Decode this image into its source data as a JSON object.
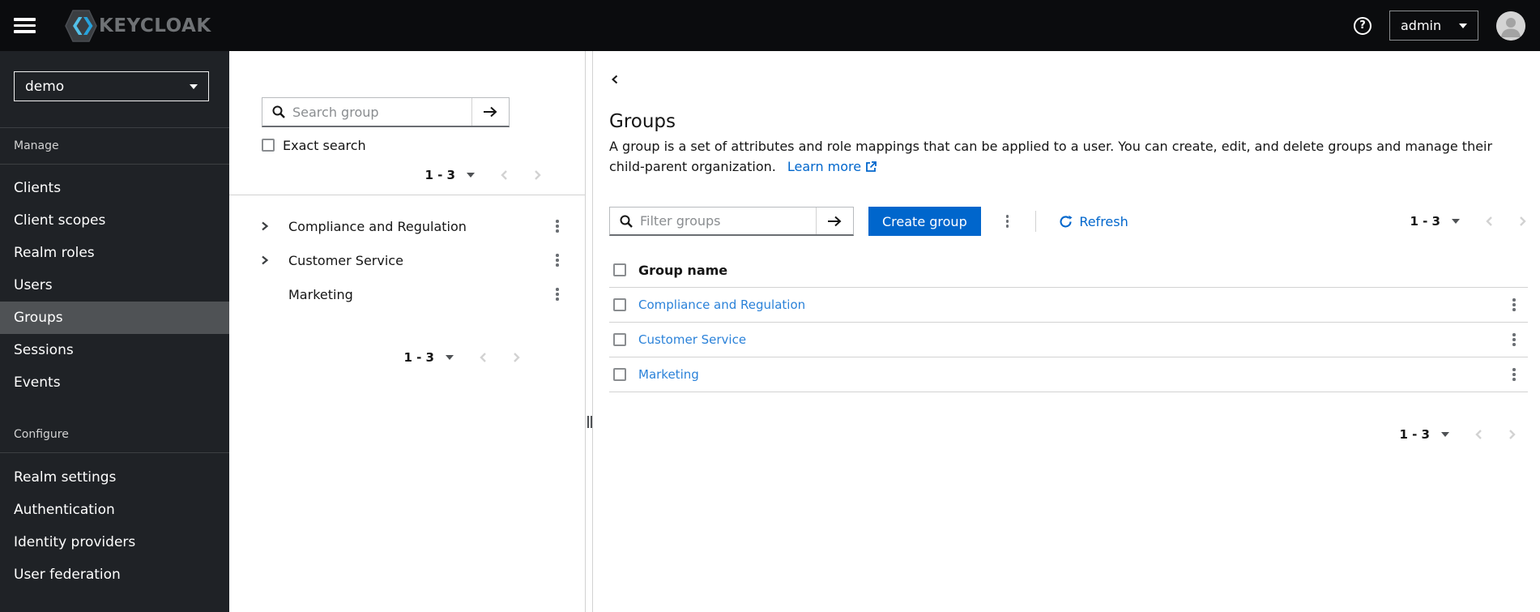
{
  "masthead": {
    "brand": "KEYCLOAK",
    "help_glyph": "?",
    "user_menu": {
      "label": "admin"
    }
  },
  "sidebar": {
    "realm_selector": {
      "value": "demo"
    },
    "sections": [
      {
        "label": "Manage",
        "items": [
          "Clients",
          "Client scopes",
          "Realm roles",
          "Users",
          "Groups",
          "Sessions",
          "Events"
        ],
        "selected": "Groups"
      },
      {
        "label": "Configure",
        "items": [
          "Realm settings",
          "Authentication",
          "Identity providers",
          "User federation"
        ]
      }
    ]
  },
  "tree_panel": {
    "search": {
      "placeholder": "Search group",
      "value": ""
    },
    "exact_search_label": "Exact search",
    "pagination": {
      "range": "1 - 3"
    },
    "items": [
      {
        "name": "Compliance and Regulation",
        "expandable": true
      },
      {
        "name": "Customer Service",
        "expandable": true
      },
      {
        "name": "Marketing",
        "expandable": false
      }
    ]
  },
  "main": {
    "title": "Groups",
    "description": "A group is a set of attributes and role mappings that can be applied to a user. You can create, edit, and delete groups and manage their child-parent organization.",
    "learn_more_label": "Learn more",
    "toolbar": {
      "filter": {
        "placeholder": "Filter groups",
        "value": ""
      },
      "create_button_label": "Create group",
      "refresh_label": "Refresh",
      "pagination": {
        "range": "1 - 3"
      }
    },
    "table": {
      "columns": [
        "Group name"
      ],
      "rows": [
        {
          "name": "Compliance and Regulation"
        },
        {
          "name": "Customer Service"
        },
        {
          "name": "Marketing"
        }
      ]
    },
    "footer_pagination": {
      "range": "1 - 3"
    }
  },
  "colors": {
    "primary": "#0066cc",
    "table_link": "#2b82d9",
    "masthead_bg": "#0b0c0e",
    "sidebar_bg": "#1f2226",
    "sidebar_selected": "#4f5255",
    "logo_blue_light": "#53c0e8",
    "logo_blue_dark": "#27a3dd"
  }
}
